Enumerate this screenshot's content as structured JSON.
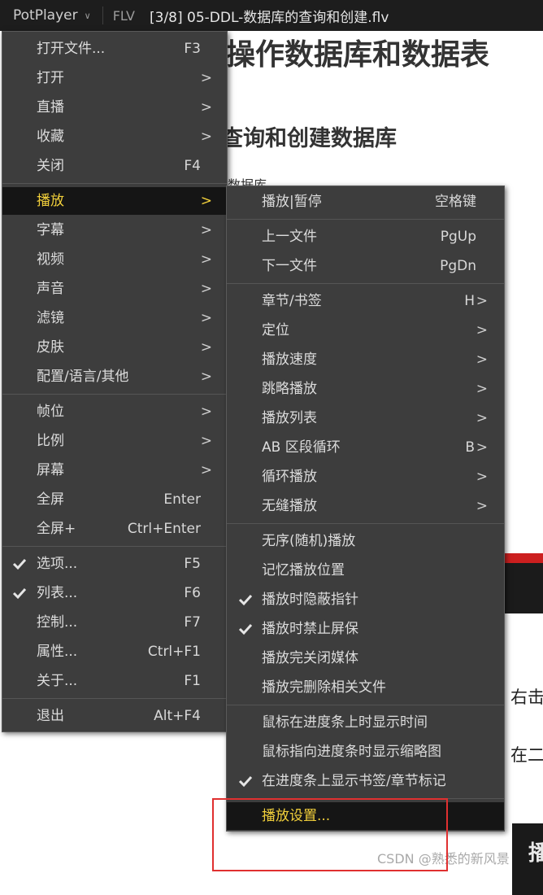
{
  "titlebar": {
    "app": "PotPlayer",
    "format": "FLV",
    "file": "[3/8] 05-DDL-数据库的查询和创建.flv"
  },
  "document": {
    "h1": "操作数据库和数据表",
    "h2": "查询和创建数据库",
    "small_text": "数据库",
    "side_text_1": "右击",
    "side_text_2": "在二",
    "bottom_char": "播",
    "watermark": "CSDN @熟悉的新风景"
  },
  "main_menu": {
    "items": [
      {
        "label": "打开文件...",
        "shortcut": "F3",
        "arrow": ""
      },
      {
        "label": "打开",
        "shortcut": "",
        "arrow": ">"
      },
      {
        "label": "直播",
        "shortcut": "",
        "arrow": ">"
      },
      {
        "label": "收藏",
        "shortcut": "",
        "arrow": ">"
      },
      {
        "label": "关闭",
        "shortcut": "F4",
        "arrow": ""
      },
      {
        "label": "播放",
        "shortcut": "",
        "arrow": ">"
      },
      {
        "label": "字幕",
        "shortcut": "",
        "arrow": ">"
      },
      {
        "label": "视频",
        "shortcut": "",
        "arrow": ">"
      },
      {
        "label": "声音",
        "shortcut": "",
        "arrow": ">"
      },
      {
        "label": "滤镜",
        "shortcut": "",
        "arrow": ">"
      },
      {
        "label": "皮肤",
        "shortcut": "",
        "arrow": ">"
      },
      {
        "label": "配置/语言/其他",
        "shortcut": "",
        "arrow": ">"
      },
      {
        "label": "帧位",
        "shortcut": "",
        "arrow": ">"
      },
      {
        "label": "比例",
        "shortcut": "",
        "arrow": ">"
      },
      {
        "label": "屏幕",
        "shortcut": "",
        "arrow": ">"
      },
      {
        "label": "全屏",
        "shortcut": "Enter",
        "arrow": ""
      },
      {
        "label": "全屏+",
        "shortcut": "Ctrl+Enter",
        "arrow": ""
      },
      {
        "label": "选项...",
        "shortcut": "F5",
        "arrow": ""
      },
      {
        "label": "列表...",
        "shortcut": "F6",
        "arrow": ""
      },
      {
        "label": "控制...",
        "shortcut": "F7",
        "arrow": ""
      },
      {
        "label": "属性...",
        "shortcut": "Ctrl+F1",
        "arrow": ""
      },
      {
        "label": "关于...",
        "shortcut": "F1",
        "arrow": ""
      },
      {
        "label": "退出",
        "shortcut": "Alt+F4",
        "arrow": ""
      }
    ]
  },
  "sub_menu": {
    "items": [
      {
        "label": "播放|暂停",
        "shortcut": "空格键",
        "arrow": ""
      },
      {
        "label": "上一文件",
        "shortcut": "PgUp",
        "arrow": ""
      },
      {
        "label": "下一文件",
        "shortcut": "PgDn",
        "arrow": ""
      },
      {
        "label": "章节/书签",
        "shortcut": "H",
        "arrow": ">"
      },
      {
        "label": "定位",
        "shortcut": "",
        "arrow": ">"
      },
      {
        "label": "播放速度",
        "shortcut": "",
        "arrow": ">"
      },
      {
        "label": "跳略播放",
        "shortcut": "",
        "arrow": ">"
      },
      {
        "label": "播放列表",
        "shortcut": "",
        "arrow": ">"
      },
      {
        "label": "AB 区段循环",
        "shortcut": "B",
        "arrow": ">"
      },
      {
        "label": "循环播放",
        "shortcut": "",
        "arrow": ">"
      },
      {
        "label": "无缝播放",
        "shortcut": "",
        "arrow": ">"
      },
      {
        "label": "无序(随机)播放",
        "shortcut": "",
        "arrow": ""
      },
      {
        "label": "记忆播放位置",
        "shortcut": "",
        "arrow": ""
      },
      {
        "label": "播放时隐蔽指针",
        "shortcut": "",
        "arrow": ""
      },
      {
        "label": "播放时禁止屏保",
        "shortcut": "",
        "arrow": ""
      },
      {
        "label": "播放完关闭媒体",
        "shortcut": "",
        "arrow": ""
      },
      {
        "label": "播放完删除相关文件",
        "shortcut": "",
        "arrow": ""
      },
      {
        "label": "鼠标在进度条上时显示时间",
        "shortcut": "",
        "arrow": ""
      },
      {
        "label": "鼠标指向进度条时显示缩略图",
        "shortcut": "",
        "arrow": ""
      },
      {
        "label": "在进度条上显示书签/章节标记",
        "shortcut": "",
        "arrow": ""
      },
      {
        "label": "播放设置...",
        "shortcut": "",
        "arrow": ""
      }
    ]
  },
  "colors": {
    "menu_bg": "#3d3d3d",
    "active_bg": "#151515",
    "active_text": "#f2d03b",
    "highlight_box": "#e03030"
  }
}
